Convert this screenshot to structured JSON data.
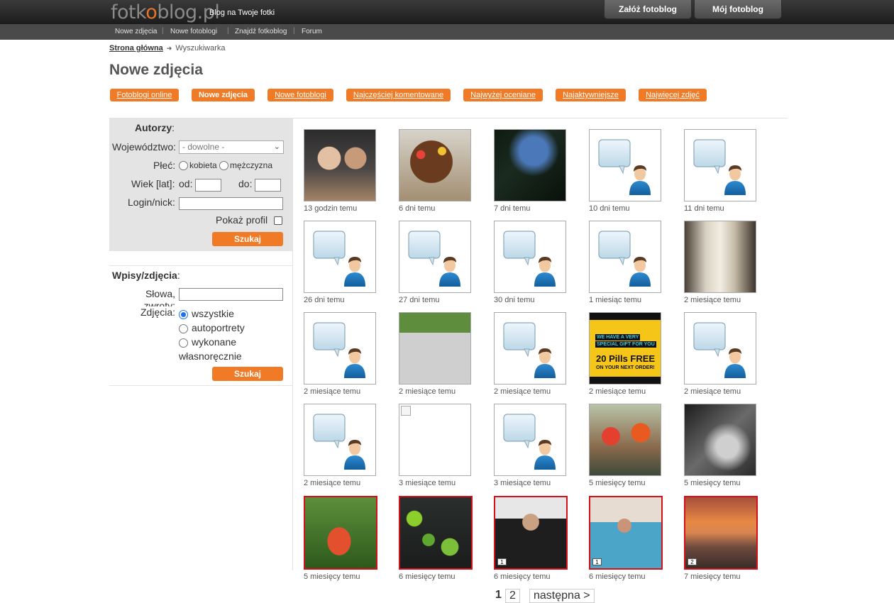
{
  "header": {
    "logo": {
      "part1": "fotk",
      "part2": "o",
      "part3": "blog.pl"
    },
    "tagline": "Blog na Twoje fotki",
    "buttons": [
      "Załóż fotoblog",
      "Mój fotoblog"
    ]
  },
  "nav": [
    "Nowe zdjęcia",
    "Nowe fotoblogi",
    "Znajdź fotkoblog",
    "Forum"
  ],
  "breadcrumb": {
    "home": "Strona główna",
    "current": "Wyszukiwarka"
  },
  "page_title": "Nowe zdjęcia",
  "tabs": [
    "Fotoblogi online",
    "Nowe zdjęcia",
    "Nowe fotoblogi",
    "Najczęściej komentowane",
    "Najwyżej oceniane",
    "Najaktywniejsze",
    "Najwięcej zdjęć"
  ],
  "authors_form": {
    "heading": "Autorzy",
    "colon": ":",
    "region_label": "Województwo:",
    "region_value": "- dowolne -",
    "gender_label": "Płeć:",
    "gender_female": "kobieta",
    "gender_male": "mężczyzna",
    "age_label": "Wiek [lat]:",
    "age_from": "od:",
    "age_to": "do:",
    "login_label": "Login/nick:",
    "profile_label": "Pokaż profil",
    "submit": "Szukaj"
  },
  "entries_form": {
    "heading": "Wpisy/zdjęcia",
    "colon": ":",
    "words_label": "Słowa, zwroty:",
    "photos_label": "Zdjęcia:",
    "opt_all": "wszystkie",
    "opt_self": "autoportrety",
    "opt_hand_1": "wykonane",
    "opt_hand_2": "własnoręcznie",
    "submit": "Szukaj"
  },
  "photos": [
    {
      "caption": "13 godzin temu",
      "kind": "photo-couple"
    },
    {
      "caption": "6 dni temu",
      "kind": "photo-cake"
    },
    {
      "caption": "7 dni temu",
      "kind": "photo-trees"
    },
    {
      "caption": "10 dni temu",
      "kind": "placeholder"
    },
    {
      "caption": "11 dni temu",
      "kind": "placeholder"
    },
    {
      "caption": "26 dni temu",
      "kind": "placeholder"
    },
    {
      "caption": "27 dni temu",
      "kind": "placeholder"
    },
    {
      "caption": "30 dni temu",
      "kind": "placeholder"
    },
    {
      "caption": "1 miesiąc temu",
      "kind": "placeholder"
    },
    {
      "caption": "2 miesiące temu",
      "kind": "photo-church"
    },
    {
      "caption": "2 miesiące temu",
      "kind": "placeholder"
    },
    {
      "caption": "2 miesiące temu",
      "kind": "photo-graffiti"
    },
    {
      "caption": "2 miesiące temu",
      "kind": "placeholder"
    },
    {
      "caption": "2 miesiące temu",
      "kind": "ad-pills",
      "text1": "WE HAVE A VERY",
      "text2": "SPECIAL GIFT FOR YOU",
      "text3": "20 Pills FREE",
      "text4": "ON YOUR NEXT ORDER!"
    },
    {
      "caption": "2 miesiące temu",
      "kind": "placeholder"
    },
    {
      "caption": "2 miesiące temu",
      "kind": "placeholder"
    },
    {
      "caption": "3 miesiące temu",
      "kind": "broken"
    },
    {
      "caption": "3 miesiące temu",
      "kind": "placeholder"
    },
    {
      "caption": "5 miesięcy temu",
      "kind": "photo-tulips"
    },
    {
      "caption": "5 miesięcy temu",
      "kind": "photo-bw"
    },
    {
      "caption": "5 miesięcy temu",
      "kind": "photo-flower",
      "featured": true
    },
    {
      "caption": "6 miesięcy temu",
      "kind": "photo-veggies",
      "featured": true
    },
    {
      "caption": "6 miesięcy temu",
      "kind": "photo-woman",
      "featured": true,
      "count": "1"
    },
    {
      "caption": "6 miesięcy temu",
      "kind": "photo-pool",
      "featured": true,
      "count": "1"
    },
    {
      "caption": "7 miesięcy temu",
      "kind": "photo-sunset",
      "featured": true,
      "count": "2"
    }
  ],
  "pagination": {
    "pages": [
      "1",
      "2"
    ],
    "current": "1",
    "next": "następna >"
  },
  "colors": {
    "accent": "#f07a26",
    "featured_border": "#d4101a"
  }
}
